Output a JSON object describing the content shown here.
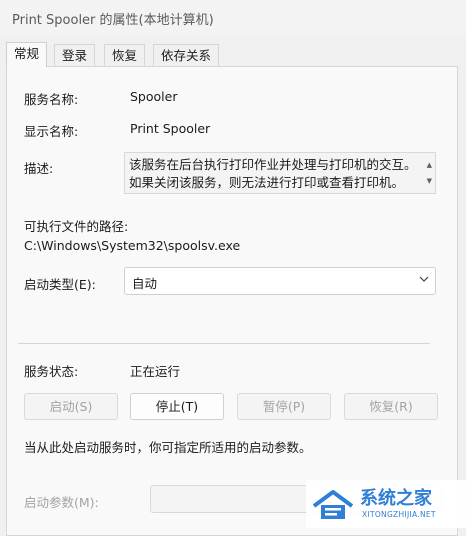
{
  "window": {
    "title": "Print Spooler 的属性(本地计算机)"
  },
  "tabs": [
    {
      "label": "常规",
      "active": true
    },
    {
      "label": "登录",
      "active": false
    },
    {
      "label": "恢复",
      "active": false
    },
    {
      "label": "依存关系",
      "active": false
    }
  ],
  "general": {
    "service_name_label": "服务名称:",
    "service_name_value": "Spooler",
    "display_name_label": "显示名称:",
    "display_name_value": "Print Spooler",
    "description_label": "描述:",
    "description_value": "该服务在后台执行打印作业并处理与打印机的交互。如果关闭该服务，则无法进行打印或查看打印机。",
    "path_label": "可执行文件的路径:",
    "path_value": "C:\\Windows\\System32\\spoolsv.exe",
    "startup_type_label": "启动类型(E):",
    "startup_type_value": "自动",
    "status_label": "服务状态:",
    "status_value": "正在运行",
    "buttons": {
      "start": "启动(S)",
      "stop": "停止(T)",
      "pause": "暂停(P)",
      "resume": "恢复(R)"
    },
    "hint": "当从此处启动服务时，你可指定所适用的启动参数。",
    "start_params_label": "启动参数(M):",
    "start_params_value": ""
  },
  "watermark": {
    "main": "系统之家",
    "sub": "XITONGZHIJIA.NET"
  },
  "colors": {
    "accent": "#2f7fd6",
    "disabled_text": "#a3a3a3"
  }
}
